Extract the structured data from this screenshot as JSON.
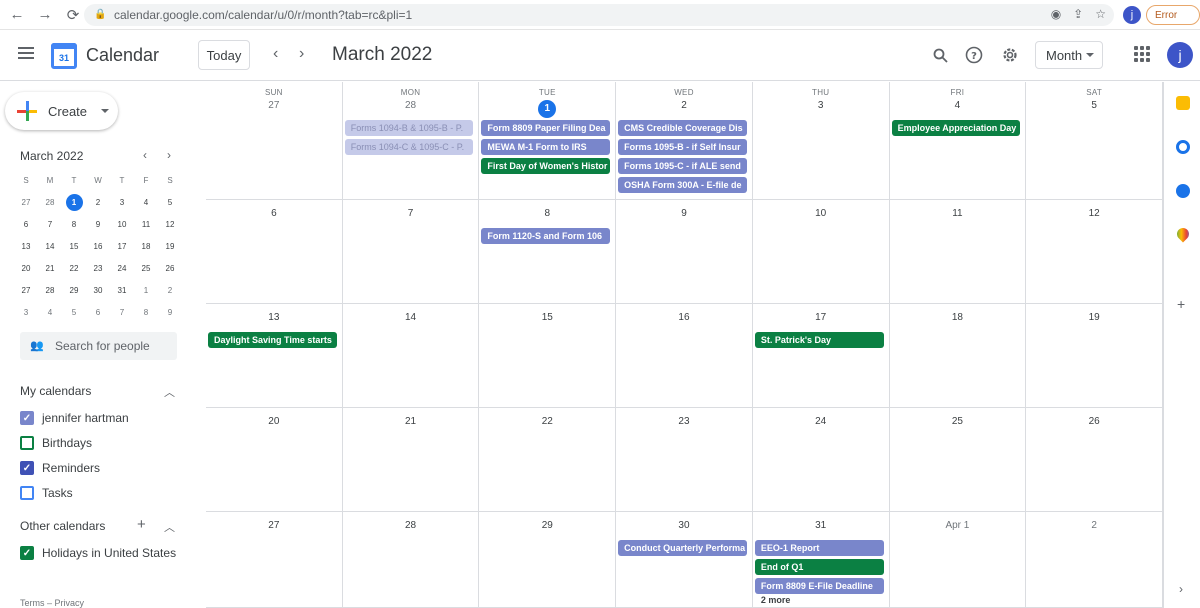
{
  "browser": {
    "back": "←",
    "forward": "→",
    "reload": "⟳",
    "url": "calendar.google.com/calendar/u/0/r/month?tab=rc&pli=1",
    "profile_initial": "j",
    "error_label": "Error"
  },
  "header": {
    "app_title": "Calendar",
    "logo_day": "31",
    "today_label": "Today",
    "prev": "‹",
    "next": "›",
    "month_title": "March 2022",
    "view_label": "Month",
    "avatar_initial": "j"
  },
  "sidebar": {
    "create_label": "Create",
    "mini_title": "March 2022",
    "mini_prev": "‹",
    "mini_next": "›",
    "mini_weekdays": [
      "S",
      "M",
      "T",
      "W",
      "T",
      "F",
      "S"
    ],
    "mini_weeks": [
      [
        "27",
        "28",
        "1",
        "2",
        "3",
        "4",
        "5"
      ],
      [
        "6",
        "7",
        "8",
        "9",
        "10",
        "11",
        "12"
      ],
      [
        "13",
        "14",
        "15",
        "16",
        "17",
        "18",
        "19"
      ],
      [
        "20",
        "21",
        "22",
        "23",
        "24",
        "25",
        "26"
      ],
      [
        "27",
        "28",
        "29",
        "30",
        "31",
        "1",
        "2"
      ],
      [
        "3",
        "4",
        "5",
        "6",
        "7",
        "8",
        "9"
      ]
    ],
    "search_people_placeholder": "Search for people",
    "my_calendars_title": "My calendars",
    "my_calendars": [
      {
        "label": "jennifer hartman",
        "checked": true,
        "color": "#7986cb"
      },
      {
        "label": "Birthdays",
        "checked": false,
        "color": "#0b8043"
      },
      {
        "label": "Reminders",
        "checked": true,
        "color": "#3f51b5"
      },
      {
        "label": "Tasks",
        "checked": false,
        "color": "#4285f4"
      }
    ],
    "other_calendars_title": "Other calendars",
    "other_calendars": [
      {
        "label": "Holidays in United States",
        "checked": true,
        "color": "#0b8043"
      }
    ],
    "footer": "Terms – Privacy"
  },
  "calendar": {
    "weekdays": [
      "SUN",
      "MON",
      "TUE",
      "WED",
      "THU",
      "FRI",
      "SAT"
    ],
    "weeks": [
      [
        "27",
        "28",
        "1",
        "2",
        "3",
        "4",
        "5"
      ],
      [
        "6",
        "7",
        "8",
        "9",
        "10",
        "11",
        "12"
      ],
      [
        "13",
        "14",
        "15",
        "16",
        "17",
        "18",
        "19"
      ],
      [
        "20",
        "21",
        "22",
        "23",
        "24",
        "25",
        "26"
      ],
      [
        "27",
        "28",
        "29",
        "30",
        "31",
        "Apr 1",
        "2"
      ]
    ],
    "events": [
      {
        "week": 0,
        "day": 1,
        "slot": 0,
        "title": "Forms 1094-B & 1095-B - P.",
        "style": "faded"
      },
      {
        "week": 0,
        "day": 1,
        "slot": 1,
        "title": "Forms 1094-C & 1095-C - P.",
        "style": "faded"
      },
      {
        "week": 0,
        "day": 2,
        "slot": 0,
        "title": "Form 8809 Paper Filing Dea",
        "style": "purple"
      },
      {
        "week": 0,
        "day": 2,
        "slot": 1,
        "title": "MEWA M-1 Form to IRS",
        "style": "purple"
      },
      {
        "week": 0,
        "day": 2,
        "slot": 2,
        "title": "First Day of Women's Histor",
        "style": "green"
      },
      {
        "week": 0,
        "day": 3,
        "slot": 0,
        "title": "CMS Credible Coverage Dis",
        "style": "purple"
      },
      {
        "week": 0,
        "day": 3,
        "slot": 1,
        "title": "Forms 1095-B - if Self Insur",
        "style": "purple"
      },
      {
        "week": 0,
        "day": 3,
        "slot": 2,
        "title": "Forms 1095-C - if ALE send",
        "style": "purple"
      },
      {
        "week": 0,
        "day": 3,
        "slot": 3,
        "title": "OSHA Form 300A - E-file de",
        "style": "purple"
      },
      {
        "week": 0,
        "day": 5,
        "slot": 0,
        "title": "Employee Appreciation Day",
        "style": "green"
      },
      {
        "week": 1,
        "day": 2,
        "slot": 0,
        "title": "Form 1120-S and Form 106",
        "style": "purple"
      },
      {
        "week": 2,
        "day": 0,
        "slot": 0,
        "title": "Daylight Saving Time starts",
        "style": "green"
      },
      {
        "week": 2,
        "day": 4,
        "slot": 0,
        "title": "St. Patrick's Day",
        "style": "green"
      },
      {
        "week": 4,
        "day": 3,
        "slot": 0,
        "title": "Conduct Quarterly Performa",
        "style": "purple"
      },
      {
        "week": 4,
        "day": 4,
        "slot": 0,
        "title": "EEO-1 Report",
        "style": "purple"
      },
      {
        "week": 4,
        "day": 4,
        "slot": 1,
        "title": "End of Q1",
        "style": "green"
      },
      {
        "week": 4,
        "day": 4,
        "slot": 2,
        "title": "Form 8809 E-File Deadline",
        "style": "purple"
      }
    ],
    "more_link": "2 more"
  },
  "colors": {
    "accent": "#1a73e8",
    "event_purple": "#7986cb",
    "event_green": "#0b8043",
    "event_faded": "#c5cae9"
  },
  "side_panel_icons": [
    "keep-icon",
    "tasks-icon",
    "contacts-icon",
    "maps-icon"
  ]
}
